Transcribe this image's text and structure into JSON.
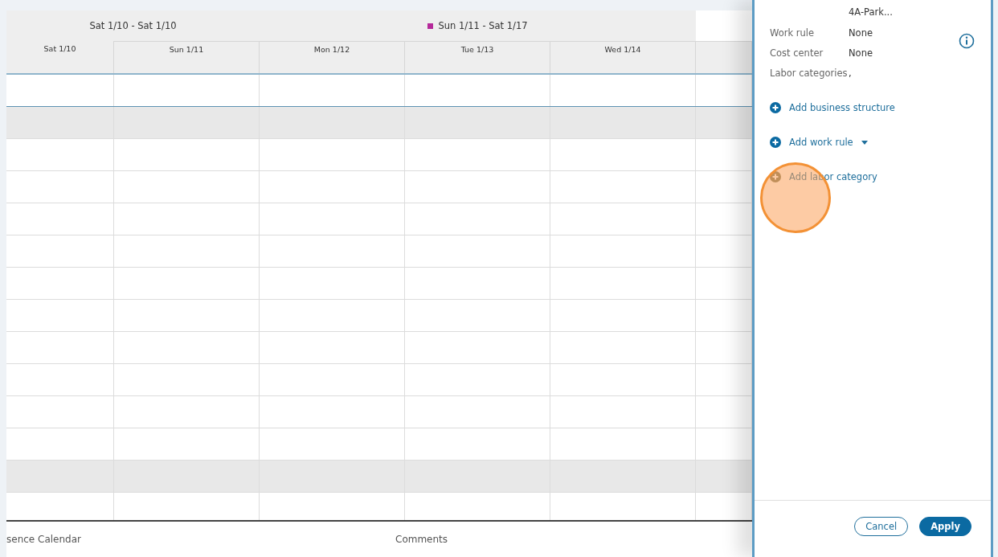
{
  "schedule": {
    "weeks": [
      {
        "label": "Sat 1/10 - Sat 1/10"
      },
      {
        "label": "Sun 1/11 - Sat 1/17",
        "color": "#b5299a"
      }
    ],
    "days": [
      {
        "label": "Sat 1/10"
      },
      {
        "label": "Sun 1/11"
      },
      {
        "label": "Mon 1/12"
      },
      {
        "label": "Tue 1/13"
      },
      {
        "label": "Wed 1/14"
      }
    ],
    "rows": [
      {
        "kind": "employee"
      },
      {
        "kind": "group"
      },
      {
        "kind": "employee"
      },
      {
        "kind": "employee"
      },
      {
        "kind": "employee"
      },
      {
        "kind": "employee"
      },
      {
        "kind": "employee"
      },
      {
        "kind": "employee"
      },
      {
        "kind": "employee"
      },
      {
        "kind": "employee"
      },
      {
        "kind": "employee"
      },
      {
        "kind": "employee"
      },
      {
        "kind": "group"
      },
      {
        "kind": "employee"
      }
    ]
  },
  "bottom_tabs": [
    "sence Calendar",
    "Comments"
  ],
  "panel": {
    "cut_value": "4A-Park...",
    "fields": [
      {
        "label": "Work rule",
        "value": "None"
      },
      {
        "label": "Cost center",
        "value": "None"
      },
      {
        "label": "Labor categories",
        "value": ","
      }
    ],
    "actions": [
      {
        "label": "Add business structure",
        "dropdown": false,
        "highlighted": false
      },
      {
        "label": "Add work rule",
        "dropdown": true,
        "highlighted": false
      },
      {
        "label": "Add labor category",
        "dropdown": false,
        "highlighted": true
      }
    ],
    "buttons": [
      {
        "label": "Cancel",
        "kind": "secondary"
      },
      {
        "label": "Apply",
        "kind": "primary"
      }
    ]
  }
}
